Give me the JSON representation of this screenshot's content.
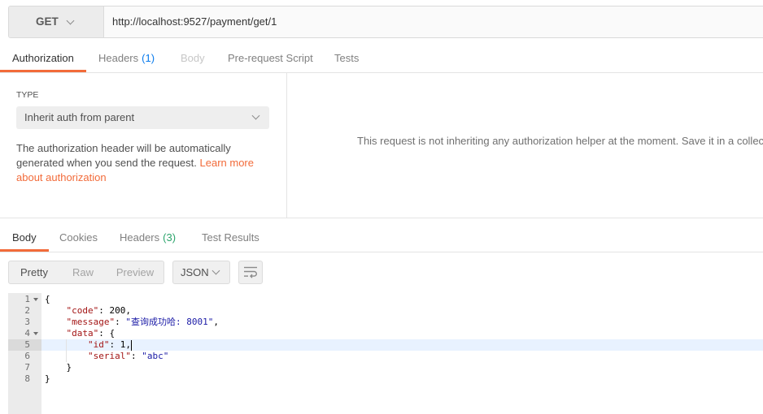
{
  "colors": {
    "accent": "#f26b3a",
    "request_count": "#097bed",
    "response_count": "#2ca46c",
    "json_key": "#a31515",
    "json_string": "#1a1aa6",
    "active_line": "#e8f2ff"
  },
  "icons": {
    "method_dropdown": "chevron-down-icon",
    "auth_type_dropdown": "chevron-down-icon",
    "format_dropdown": "chevron-down-icon",
    "wrap": "wrap-lines-icon",
    "fold": "fold-arrow-icon"
  },
  "request": {
    "method": "GET",
    "url": "http://localhost:9527/payment/get/1"
  },
  "request_tabs": [
    {
      "label": "Authorization",
      "active": true
    },
    {
      "label": "Headers",
      "count": "(1)"
    },
    {
      "label": "Body",
      "disabled": true
    },
    {
      "label": "Pre-request Script"
    },
    {
      "label": "Tests"
    }
  ],
  "auth": {
    "type_label": "TYPE",
    "type_value": "Inherit auth from parent",
    "help_text": "The authorization header will be automatically generated when you send the request. ",
    "help_link": "Learn more about authorization",
    "message": "This request is not inheriting any authorization helper at the moment. Save it in a collectio"
  },
  "response_tabs": [
    {
      "label": "Body",
      "active": true
    },
    {
      "label": "Cookies"
    },
    {
      "label": "Headers",
      "count": "(3)"
    },
    {
      "label": "Test Results"
    }
  ],
  "response_toolbar": {
    "view_modes": [
      {
        "label": "Pretty",
        "active": true
      },
      {
        "label": "Raw"
      },
      {
        "label": "Preview"
      }
    ],
    "format": "JSON"
  },
  "response_body": {
    "active_line": 5,
    "lines": [
      {
        "num": "1",
        "fold": true,
        "text": "{"
      },
      {
        "num": "2",
        "key": "\"code\"",
        "colon": ": ",
        "value": "200",
        "end": ","
      },
      {
        "num": "3",
        "key": "\"message\"",
        "colon": ": ",
        "value": "\"查询成功哈: 8001\"",
        "end": ","
      },
      {
        "num": "4",
        "fold": true,
        "key": "\"data\"",
        "colon": ": ",
        "value": "{"
      },
      {
        "num": "5",
        "key": "\"id\"",
        "colon": ": ",
        "value": "1",
        "end": ","
      },
      {
        "num": "6",
        "key": "\"serial\"",
        "colon": ": ",
        "value": "\"abc\""
      },
      {
        "num": "7",
        "text": "}"
      },
      {
        "num": "8",
        "text": "}"
      }
    ]
  }
}
